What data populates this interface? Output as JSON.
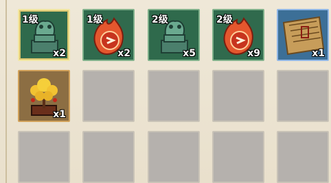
{
  "inventory": {
    "slots": [
      {
        "level": "1级",
        "count": "x2",
        "icon": "jade-seal-icon"
      },
      {
        "level": "1级",
        "count": "x2",
        "icon": "flame-token-icon"
      },
      {
        "level": "2级",
        "count": "x5",
        "icon": "jade-seal-icon"
      },
      {
        "level": "2级",
        "count": "x9",
        "icon": "flame-token-icon"
      },
      {
        "level": "",
        "count": "x1",
        "icon": "scroll-map-icon"
      },
      {
        "level": "",
        "count": "x1",
        "icon": "money-tree-icon"
      }
    ]
  },
  "colors": {
    "jade": "#2f6a4c",
    "flame": "#e4572e",
    "scroll": "#c79d5a",
    "empty_slot": "#b5b1ad",
    "background": "#ece4d3"
  }
}
